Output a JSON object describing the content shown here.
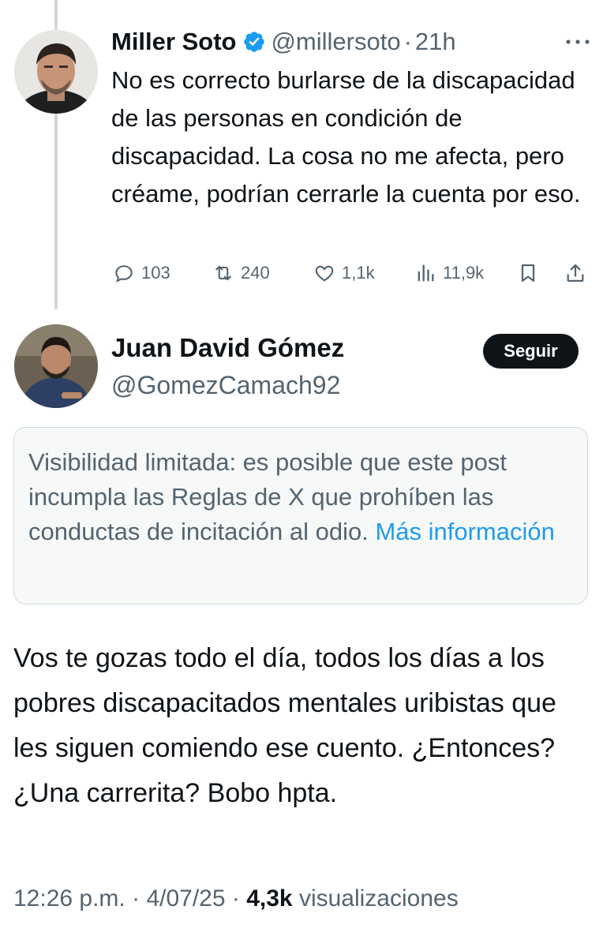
{
  "parent_tweet": {
    "author_name": "Miller Soto",
    "verified_icon": "verified-badge-icon",
    "handle": "@millersoto",
    "separator": "·",
    "time_ago": "21h",
    "text": "No es correcto burlarse de la discapacidad de las personas en condición de discapacidad. La cosa no me afecta, pero créame, podrían cerrarle la cuenta por eso.",
    "stats": {
      "replies": "103",
      "reposts": "240",
      "likes": "1,1k",
      "views": "11,9k"
    }
  },
  "reply_tweet": {
    "author_name": "Juan David Gómez",
    "handle": "@GomezCamach92",
    "follow_label": "Seguir",
    "notice_text": "Visibilidad limitada: es posible que este post incumpla las Reglas de X que prohíben las conductas de incitación al odio. ",
    "notice_link": "Más información",
    "text": "Vos te gozas todo el día, todos los días a los pobres discapacitados mentales uribistas que les siguen comiendo ese cuento. ¿Entonces? ¿Una carrerita? Bobo hpta.",
    "time": "12:26 p.m.",
    "date": "4/07/25",
    "views_count": "4,3k",
    "views_label": "visualizaciones"
  },
  "colors": {
    "accent": "#1d9bf0",
    "text": "#0f1419",
    "secondary": "#536471",
    "border": "#cfd9de"
  }
}
